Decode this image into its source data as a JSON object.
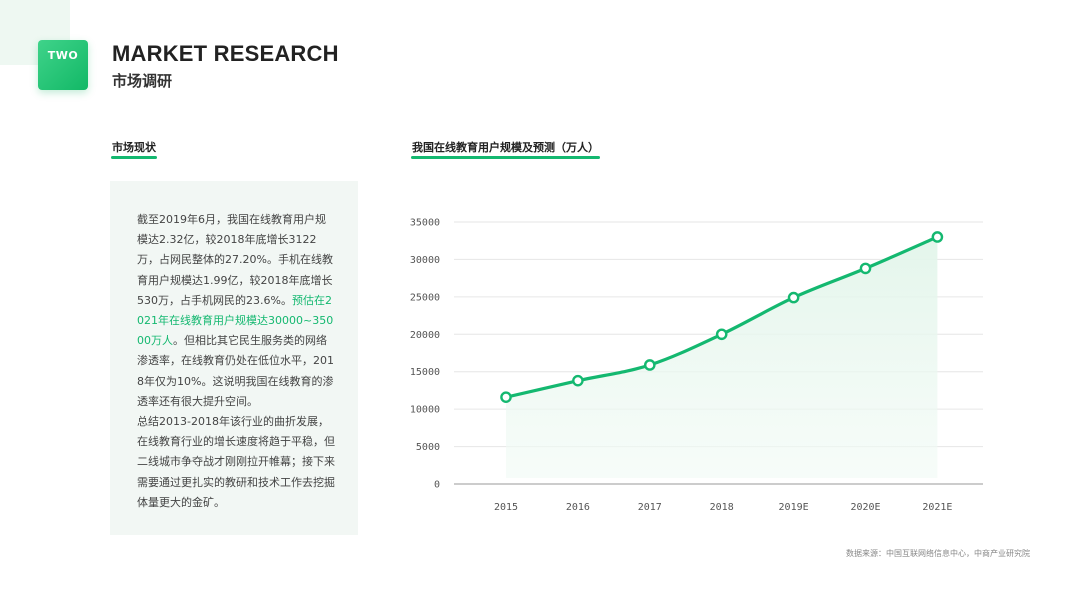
{
  "header": {
    "badge": "TWO",
    "title_en": "MARKET RESEARCH",
    "title_cn": "市场调研"
  },
  "left_section": {
    "label": "市场现状",
    "paragraph1_before": "截至2019年6月，我国在线教育用户规模达2.32亿，较2018年底增长3122万，占网民整体的27.20%。手机在线教育用户规模达1.99亿，较2018年底增长530万，占手机网民的23.6%。",
    "paragraph1_highlight": "预估在2021年在线教育用户规模达30000~35000万人",
    "paragraph1_after": "。但相比其它民生服务类的网络渗透率，在线教育仍处在低位水平，2018年仅为10%。这说明我国在线教育的渗透率还有很大提升空间。",
    "paragraph2": "总结2013-2018年该行业的曲折发展，在线教育行业的增长速度将趋于平稳，但二线城市争夺战才刚刚拉开帷幕；接下来需要通过更扎实的教研和技术工作去挖掘体量更大的金矿。"
  },
  "right_section": {
    "label": "我国在线教育用户规模及预测（万人）"
  },
  "source": "数据来源：中国互联网络信息中心，中商产业研究院",
  "colors": {
    "accent": "#14b870",
    "area_fill": "#e9f7ef",
    "panel_bg": "#f2f7f4",
    "gridline": "#e6e6e6",
    "axis": "#999999"
  },
  "chart_data": {
    "type": "line",
    "title": "我国在线教育用户规模及预测（万人）",
    "xlabel": "",
    "ylabel": "",
    "categories": [
      "2015",
      "2016",
      "2017",
      "2018",
      "2019E",
      "2020E",
      "2021E"
    ],
    "series": [
      {
        "values": [
          11600,
          13800,
          15900,
          20000,
          24900,
          28800,
          33000
        ]
      }
    ],
    "ylim": [
      0,
      35000
    ],
    "yticks": [
      0,
      5000,
      10000,
      15000,
      20000,
      25000,
      30000,
      35000
    ],
    "grid": true,
    "area_fill": true,
    "markers": "hollow-circle",
    "legend": "none"
  }
}
